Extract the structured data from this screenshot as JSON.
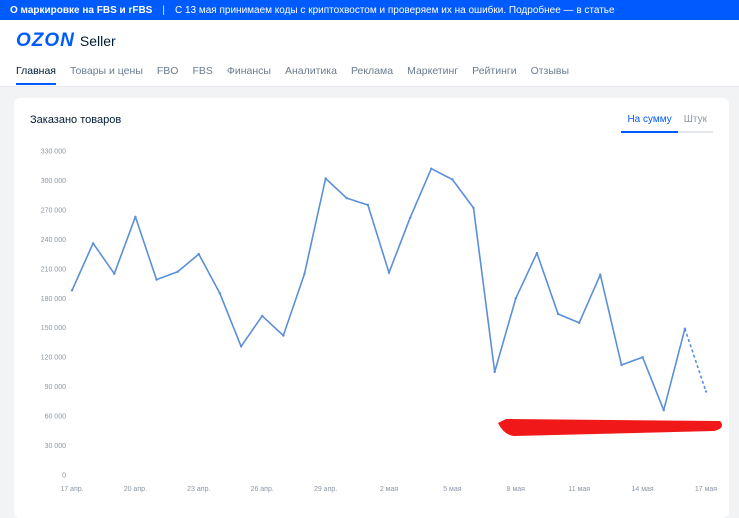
{
  "banner": {
    "bold": "О маркировке на FBS и rFBS",
    "separator": "|",
    "text": "С 13 мая принимаем коды с криптохвостом и проверяем их на ошибки. Подробнее — в статье"
  },
  "logo": {
    "brand": "OZON",
    "product": "Seller"
  },
  "nav": {
    "tabs": [
      {
        "label": "Главная"
      },
      {
        "label": "Товары и цены"
      },
      {
        "label": "FBO"
      },
      {
        "label": "FBS"
      },
      {
        "label": "Финансы"
      },
      {
        "label": "Аналитика"
      },
      {
        "label": "Реклама"
      },
      {
        "label": "Маркетинг"
      },
      {
        "label": "Рейтинги"
      },
      {
        "label": "Отзывы"
      }
    ]
  },
  "card": {
    "title": "Заказано товаров",
    "toggle": [
      {
        "label": "На сумму"
      },
      {
        "label": "Штук"
      }
    ]
  },
  "colors": {
    "accent": "#005bff",
    "line": "#5b8fd9",
    "redact": "#f01818"
  },
  "chart_data": {
    "type": "line",
    "yticks": [
      0,
      30000,
      60000,
      90000,
      120000,
      150000,
      180000,
      210000,
      240000,
      270000,
      300000,
      330000
    ],
    "ytick_labels": [
      "0",
      "30 000",
      "60 000",
      "90 000",
      "120 000",
      "150 000",
      "180 000",
      "210 000",
      "240 000",
      "270 000",
      "300 000",
      "330 000"
    ],
    "ylim": [
      0,
      330000
    ],
    "x_tick_labels": [
      "17 апр.",
      "20 апр.",
      "23 апр.",
      "26 апр.",
      "29 апр.",
      "2 мая",
      "5 мая",
      "8 мая",
      "11 мая",
      "14 мая",
      "17 мая"
    ],
    "x_tick_index": [
      0,
      3,
      6,
      9,
      12,
      15,
      18,
      21,
      24,
      27,
      30
    ],
    "values": [
      188000,
      236000,
      205000,
      263000,
      199000,
      207000,
      225000,
      185000,
      131000,
      162000,
      142000,
      205000,
      302000,
      282000,
      275000,
      206000,
      262000,
      312000,
      301000,
      272000,
      105000,
      180000,
      226000,
      164000,
      155000,
      204000,
      112000,
      120000,
      66000,
      149000,
      85000
    ],
    "dashed_last_segment": true,
    "grid": false
  }
}
